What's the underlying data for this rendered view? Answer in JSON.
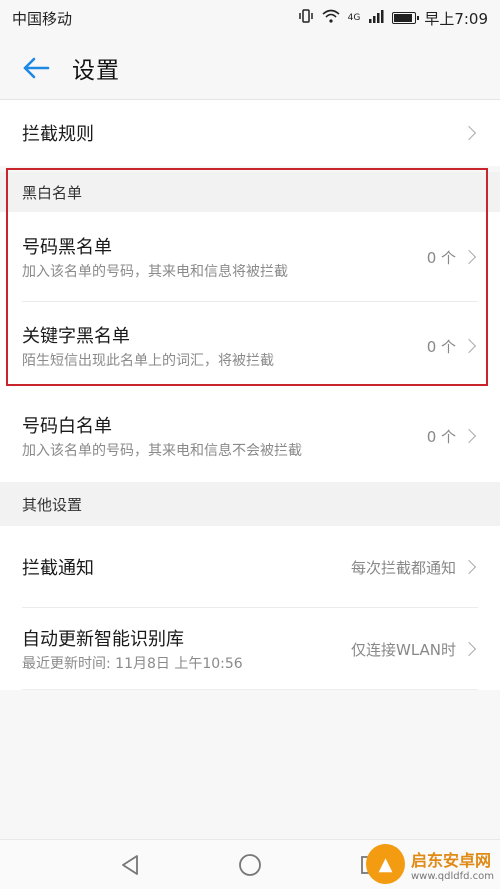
{
  "status_bar": {
    "carrier": "中国移动",
    "time": "早上7:09",
    "signal_label": "4G"
  },
  "app_bar": {
    "title": "设置"
  },
  "rows": {
    "intercept_rules": {
      "title": "拦截规则"
    },
    "number_blacklist": {
      "title": "号码黑名单",
      "sub": "加入该名单的号码，其来电和信息将被拦截",
      "value": "0 个"
    },
    "keyword_blacklist": {
      "title": "关键字黑名单",
      "sub": "陌生短信出现此名单上的词汇，将被拦截",
      "value": "0 个"
    },
    "number_whitelist": {
      "title": "号码白名单",
      "sub": "加入该名单的号码，其来电和信息不会被拦截",
      "value": "0 个"
    },
    "intercept_notify": {
      "title": "拦截通知",
      "value": "每次拦截都通知"
    },
    "auto_update": {
      "title": "自动更新智能识别库",
      "sub": "最近更新时间: 11月8日 上午10:56",
      "value": "仅连接WLAN时"
    }
  },
  "sections": {
    "black_white": "黑白名单",
    "other": "其他设置"
  },
  "watermark": {
    "name": "启东安卓网",
    "url": "www.qdldfd.com"
  },
  "colors": {
    "accent": "#1e88e5",
    "highlight": "#c9252c"
  }
}
